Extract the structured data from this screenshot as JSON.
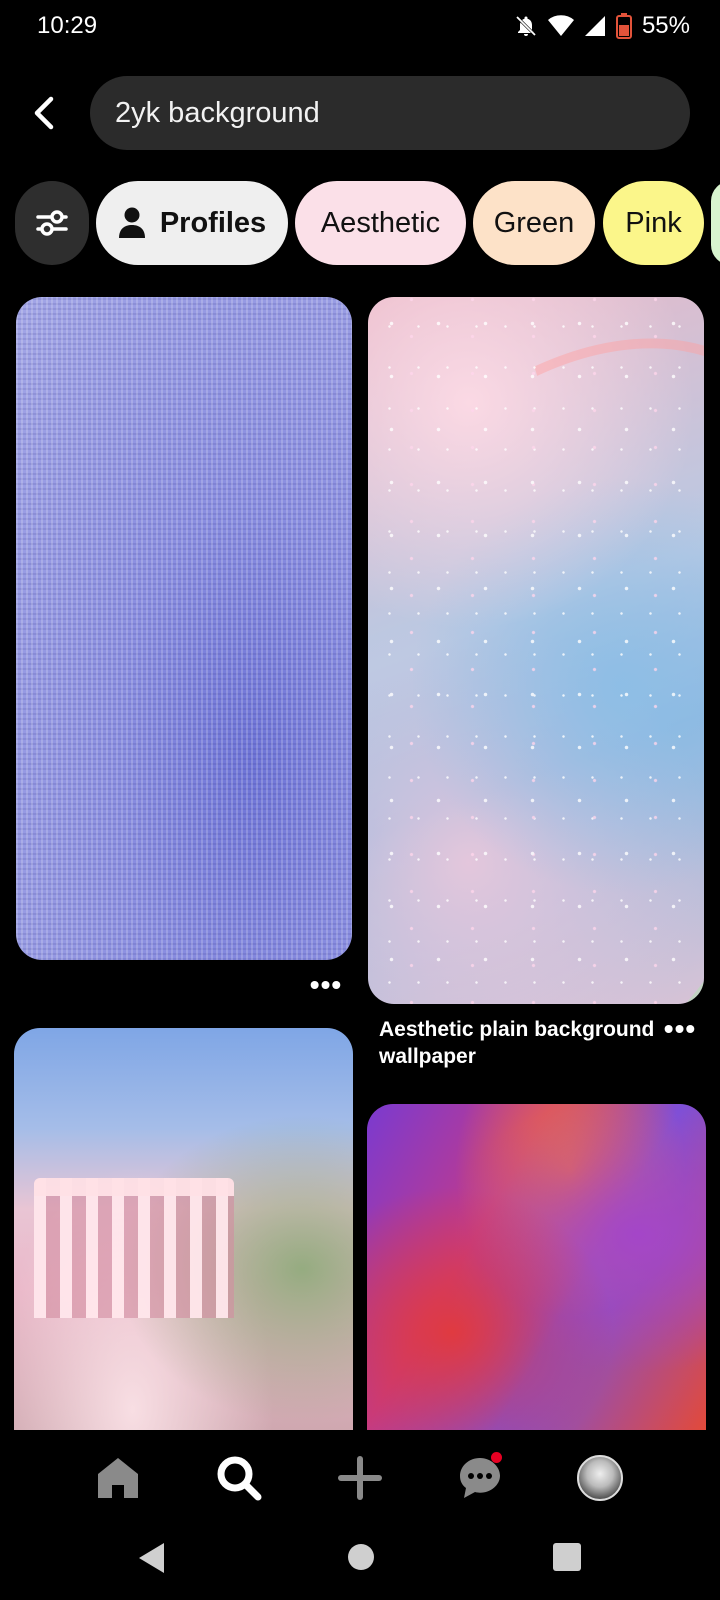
{
  "status_bar": {
    "time": "10:29",
    "battery": "55%",
    "icons": [
      "notifications-off-icon",
      "wifi-icon",
      "signal-icon",
      "battery-icon"
    ]
  },
  "search": {
    "query": "2yk background"
  },
  "chips": [
    {
      "label": "Profiles",
      "icon": "person-icon",
      "color": "#efefef"
    },
    {
      "label": "Aesthetic",
      "color": "#fbe0e8"
    },
    {
      "label": "Green",
      "color": "#fde2c8"
    },
    {
      "label": "Pink",
      "color": "#fbf68a"
    }
  ],
  "pins": [
    {
      "title": ""
    },
    {
      "title": "Aesthetic plain background wallpaper"
    },
    {
      "title": ""
    },
    {
      "title": ""
    }
  ],
  "bottom_nav": {
    "items": [
      "home-icon",
      "search-icon",
      "create-icon",
      "messages-icon",
      "profile-avatar"
    ],
    "active": "search-icon",
    "notification_color": "#e60023"
  },
  "system_nav": [
    "back-icon",
    "home-icon",
    "recents-icon"
  ]
}
